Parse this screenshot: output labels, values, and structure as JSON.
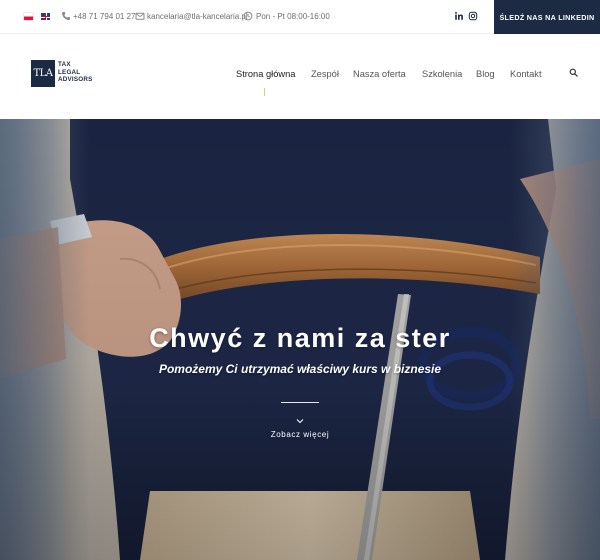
{
  "topbar": {
    "languages": [
      "pl",
      "en"
    ],
    "phone_icon": "phone-icon",
    "phone": "+48 71 794 01 27",
    "email_icon": "mail-icon",
    "email": "kancelaria@tla-kancelaria.pl",
    "hours_icon": "clock-icon",
    "hours": "Pon - Pt 08:00-16:00",
    "social": [
      "linkedin-icon",
      "instagram-icon"
    ],
    "cta_label": "ŚLEDŹ NAS NA LINKEDIN"
  },
  "header": {
    "logo": {
      "mark": "TLA",
      "line1": "TAX",
      "line2": "LEGAL",
      "line3": "ADVISORS"
    },
    "nav": [
      {
        "label": "Strona główna",
        "active": true
      },
      {
        "label": "Zespół",
        "active": false
      },
      {
        "label": "Nasza oferta",
        "active": false
      },
      {
        "label": "Szkolenia",
        "active": false
      },
      {
        "label": "Blog",
        "active": false
      },
      {
        "label": "Kontakt",
        "active": false
      }
    ],
    "search_icon": "search-icon"
  },
  "hero": {
    "title": "Chwyć z nami za ster",
    "subtitle": "Pomożemy Ci utrzymać właściwy kurs w biznesie",
    "chevron_icon": "chevron-down-icon",
    "more_label": "Zobacz więcej"
  },
  "colors": {
    "brand_navy": "#1d2a44",
    "accent_gold": "#e3c888",
    "text_gray": "#6e6e6e"
  }
}
